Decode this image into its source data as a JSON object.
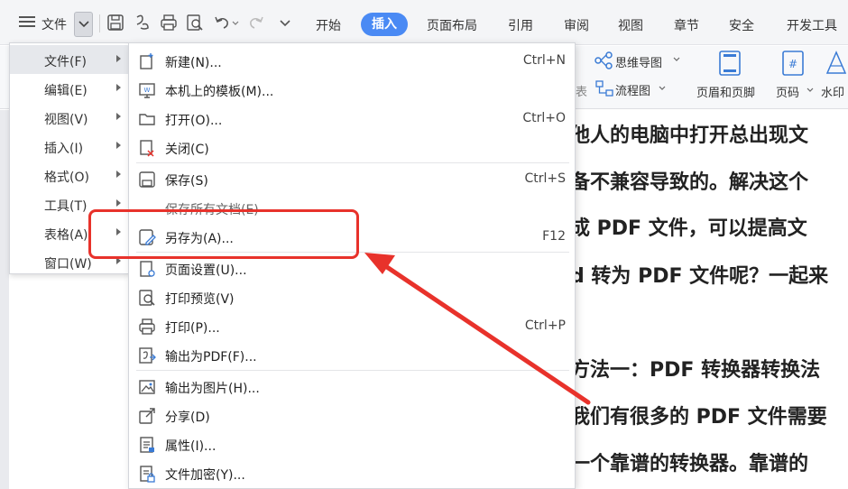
{
  "toolbar": {
    "file_label": "文件",
    "tabs": [
      {
        "label": "开始",
        "active": false
      },
      {
        "label": "插入",
        "active": true
      },
      {
        "label": "页面布局",
        "active": false
      },
      {
        "label": "引用",
        "active": false
      },
      {
        "label": "审阅",
        "active": false
      },
      {
        "label": "视图",
        "active": false
      },
      {
        "label": "章节",
        "active": false
      },
      {
        "label": "安全",
        "active": false
      },
      {
        "label": "开发工具",
        "active": false
      }
    ]
  },
  "ribbon": {
    "mind_map": "思维导图",
    "flowchart": "流程图",
    "header_footer": "页眉和页脚",
    "page_number": "页码",
    "watermark": "水印"
  },
  "left_menu": {
    "items": [
      {
        "label": "文件(F)"
      },
      {
        "label": "编辑(E)"
      },
      {
        "label": "视图(V)"
      },
      {
        "label": "插入(I)"
      },
      {
        "label": "格式(O)"
      },
      {
        "label": "工具(T)"
      },
      {
        "label": "表格(A)"
      },
      {
        "label": "窗口(W)"
      }
    ]
  },
  "submenu": {
    "items": [
      {
        "label": "新建(N)...",
        "shortcut": "Ctrl+N"
      },
      {
        "label": "本机上的模板(M)...",
        "shortcut": ""
      },
      {
        "label": "打开(O)...",
        "shortcut": "Ctrl+O"
      },
      {
        "label": "关闭(C)",
        "shortcut": ""
      },
      {
        "label": "保存(S)",
        "shortcut": "Ctrl+S"
      },
      {
        "label": "保存所有文档(E)",
        "shortcut": ""
      },
      {
        "label": "另存为(A)...",
        "shortcut": "F12"
      },
      {
        "label": "页面设置(U)...",
        "shortcut": ""
      },
      {
        "label": "打印预览(V)",
        "shortcut": ""
      },
      {
        "label": "打印(P)...",
        "shortcut": "Ctrl+P"
      },
      {
        "label": "输出为PDF(F)...",
        "shortcut": ""
      },
      {
        "label": "输出为图片(H)...",
        "shortcut": ""
      },
      {
        "label": "分享(D)",
        "shortcut": ""
      },
      {
        "label": "属性(I)...",
        "shortcut": ""
      },
      {
        "label": "文件加密(Y)...",
        "shortcut": ""
      }
    ]
  },
  "document": {
    "lines": [
      "他人的电脑中打开总出现文",
      "备不兼容导致的。解决这个",
      "成 PDF 文件，可以提高文",
      "d 转为 PDF 文件呢？一起来",
      "",
      "方法一：PDF 转换器转换法",
      "我们有很多的 PDF 文件需要",
      "一个靠谱的转换器。靠谱的"
    ]
  },
  "colors": {
    "accent": "#4a8af4",
    "annotation": "#e8322b"
  }
}
